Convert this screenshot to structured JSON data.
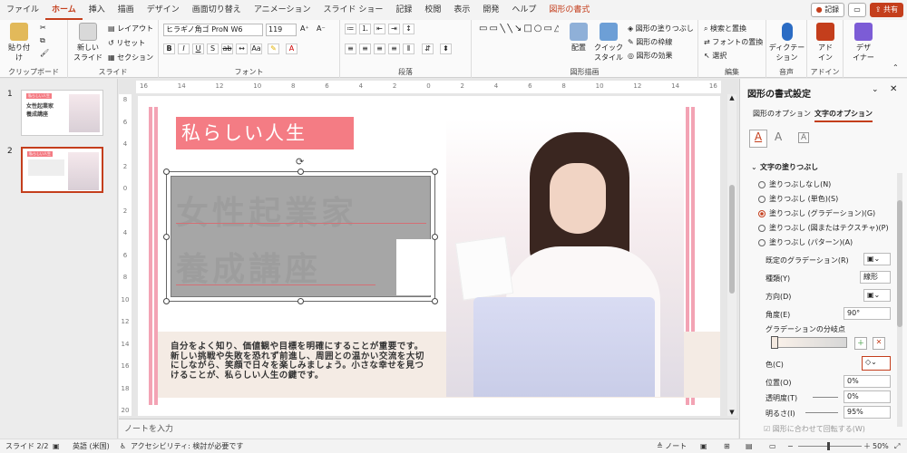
{
  "tabs": [
    "ファイル",
    "ホーム",
    "挿入",
    "描画",
    "デザイン",
    "画面切り替え",
    "アニメーション",
    "スライド ショー",
    "記録",
    "校閲",
    "表示",
    "開発",
    "ヘルプ",
    "図形の書式"
  ],
  "top_right": {
    "record": "記録",
    "share": "共有"
  },
  "ribbon": {
    "paste": "貼り付け",
    "new_slide": "新しい\nスライド",
    "layout": "レイアウト",
    "reset": "リセット",
    "section": "セクション",
    "font_name": "ヒラギノ角ゴ ProN W6",
    "font_size": "119",
    "shape_fill": "図形の塗りつぶし",
    "shape_outline": "図形の枠線",
    "shape_effect": "図形の効果",
    "arrange": "配置",
    "quick_style": "クイック\nスタイル",
    "find_replace": "検索と置換",
    "font_replace": "フォントの置換",
    "select": "選択",
    "dictation": "ディクテー\nション",
    "addin": "アド\nイン",
    "designer": "デザ\nイナー",
    "group_labels": [
      "クリップボード",
      "スライド",
      "フォント",
      "段落",
      "図形描画",
      "編集",
      "音声",
      "アドイン"
    ]
  },
  "slide": {
    "header": "私らしい人生",
    "title_line1": "女性起業家",
    "title_line2": "養成講座",
    "body": "自分をよく知り、価値観や目標を明確にすることが重要です。新しい挑戦や失敗を恐れず前進し、周囲との温かい交流を大切にしながら、笑顔で日々を楽しみましょう。小さな幸せを見つけることが、私らしい人生の鍵です。"
  },
  "thumbnails": [
    {
      "num": "1",
      "header": "私らしい人生",
      "title": "女性起業家\n養成講座"
    },
    {
      "num": "2",
      "header": "私らしい人生"
    }
  ],
  "ruler": {
    "h": [
      "16",
      "14",
      "12",
      "10",
      "8",
      "6",
      "4",
      "2",
      "0",
      "2",
      "4",
      "6",
      "8",
      "10",
      "12",
      "14",
      "16"
    ],
    "v": [
      "8",
      "6",
      "4",
      "2",
      "0",
      "2",
      "4",
      "6",
      "8",
      "10",
      "12",
      "14",
      "16",
      "18",
      "20"
    ]
  },
  "notes_placeholder": "ノートを入力",
  "status": {
    "slide": "スライド 2/2",
    "lang": "英語 (米国)",
    "access": "アクセシビリティ: 検討が必要です",
    "notes": "ノート",
    "zoom": "50%"
  },
  "pane": {
    "title": "図形の書式設定",
    "tab_shape": "図形のオプション",
    "tab_text": "文字のオプション",
    "section": "文字の塗りつぶし",
    "options": [
      "塗りつぶしなし(N)",
      "塗りつぶし (単色)(S)",
      "塗りつぶし (グラデーション)(G)",
      "塗りつぶし (図またはテクスチャ)(P)",
      "塗りつぶし (パターン)(A)"
    ],
    "preset": "既定のグラデーション(R)",
    "type_label": "種類(Y)",
    "type_value": "線形",
    "direction": "方向(D)",
    "angle_label": "角度(E)",
    "angle_value": "90°",
    "stops_label": "グラデーションの分岐点",
    "color_label": "色(C)",
    "position_label": "位置(O)",
    "position_value": "0%",
    "transparency_label": "透明度(T)",
    "transparency_value": "0%",
    "brightness_label": "明るさ(I)",
    "brightness_value": "95%",
    "rotate": "図形に合わせて回転する(W)"
  }
}
